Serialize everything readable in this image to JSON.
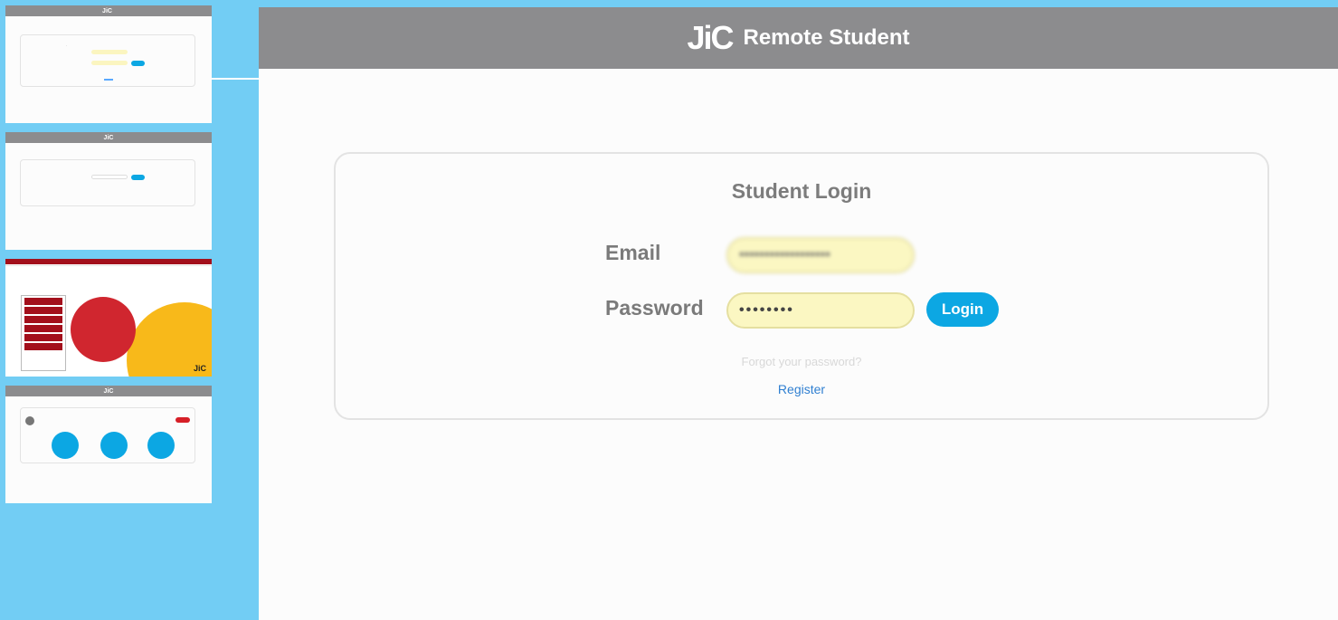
{
  "header": {
    "logo_text": "JiC",
    "title": "Remote Student"
  },
  "login": {
    "title": "Student Login",
    "email_label": "Email",
    "email_value": "••••••••••••••••••",
    "password_label": "Password",
    "password_value": "••••••••",
    "login_button": "Login",
    "forgot_link": "Forgot your password?",
    "register_link": "Register"
  },
  "thumbnails": {
    "t3_logo": "JiC"
  },
  "colors": {
    "background": "#72cdf4",
    "header": "#8c8c8e",
    "accent": "#0ca7e3",
    "field": "#fbf7c2",
    "link": "#2f7fd1"
  }
}
